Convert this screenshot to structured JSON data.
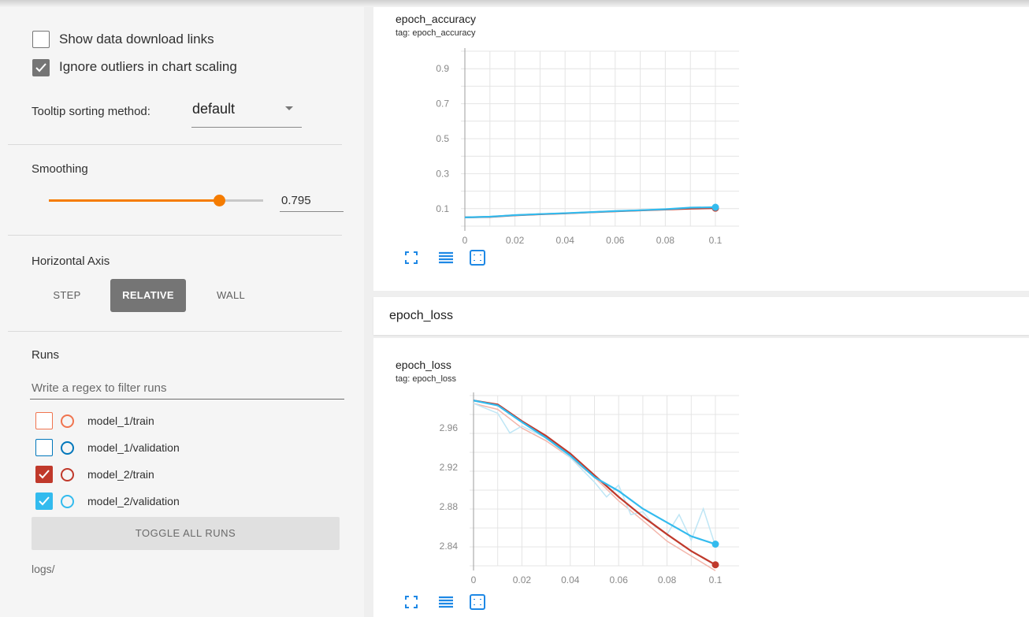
{
  "sidebar": {
    "show_download_links": {
      "label": "Show data download links",
      "checked": false
    },
    "ignore_outliers": {
      "label": "Ignore outliers in chart scaling",
      "checked": true
    },
    "tooltip_sorting": {
      "label": "Tooltip sorting method:",
      "value": "default"
    },
    "smoothing": {
      "label": "Smoothing",
      "value": "0.795",
      "fraction": 0.795
    },
    "horizontal_axis": {
      "label": "Horizontal Axis",
      "options": [
        "STEP",
        "RELATIVE",
        "WALL"
      ],
      "selected": "RELATIVE"
    },
    "runs": {
      "label": "Runs",
      "filter_placeholder": "Write a regex to filter runs",
      "items": [
        {
          "name": "model_1/train",
          "checked": false,
          "color": "#f0744f"
        },
        {
          "name": "model_1/validation",
          "checked": false,
          "color": "#0077bb"
        },
        {
          "name": "model_2/train",
          "checked": true,
          "color": "#c0392b"
        },
        {
          "name": "model_2/validation",
          "checked": true,
          "color": "#33bbee"
        }
      ],
      "toggle_label": "TOGGLE ALL RUNS",
      "log_dir": "logs/"
    }
  },
  "main": {
    "group_title": "epoch_loss",
    "icons": [
      "fit-domain-icon",
      "toggle-log-scale-icon",
      "data-selection-icon"
    ]
  },
  "chart_data": [
    {
      "type": "line",
      "title": "epoch_accuracy",
      "subtitle": "tag: epoch_accuracy",
      "xlim": [
        0,
        0.1
      ],
      "ylim": [
        0,
        1
      ],
      "x_ticks": [
        "0",
        "0.02",
        "0.04",
        "0.06",
        "0.08",
        "0.1"
      ],
      "y_ticks": [
        "0.9",
        "0.7",
        "0.5",
        "0.3",
        "0.1"
      ],
      "grid": true,
      "series": [
        {
          "name": "model_2/train",
          "color": "#c0392b",
          "x": [
            0,
            0.01,
            0.02,
            0.03,
            0.04,
            0.05,
            0.06,
            0.07,
            0.08,
            0.09,
            0.1
          ],
          "y": [
            0.05,
            0.053,
            0.062,
            0.068,
            0.073,
            0.079,
            0.085,
            0.09,
            0.095,
            0.1,
            0.103
          ]
        },
        {
          "name": "model_2/validation",
          "color": "#33bbee",
          "x": [
            0,
            0.01,
            0.02,
            0.03,
            0.04,
            0.05,
            0.06,
            0.07,
            0.08,
            0.09,
            0.1
          ],
          "y": [
            0.05,
            0.054,
            0.063,
            0.069,
            0.074,
            0.08,
            0.086,
            0.091,
            0.097,
            0.106,
            0.108
          ]
        }
      ]
    },
    {
      "type": "line",
      "title": "epoch_loss",
      "subtitle": "tag: epoch_loss",
      "xlim": [
        0,
        0.1
      ],
      "ylim": [
        2.82,
        2.993
      ],
      "x_ticks": [
        "0",
        "0.02",
        "0.04",
        "0.06",
        "0.08",
        "0.1"
      ],
      "y_ticks": [
        "2.96",
        "2.92",
        "2.88",
        "2.84"
      ],
      "grid": true,
      "series": [
        {
          "name": "model_2/train (raw)",
          "color": "#f3b6ab",
          "x": [
            0,
            0.01,
            0.02,
            0.03,
            0.04,
            0.05,
            0.06,
            0.07,
            0.08,
            0.09,
            0.1
          ],
          "y": [
            2.985,
            2.979,
            2.96,
            2.947,
            2.93,
            2.91,
            2.886,
            2.866,
            2.845,
            2.83,
            2.815
          ]
        },
        {
          "name": "model_2/validation (raw)",
          "color": "#bfe6f5",
          "x": [
            0,
            0.01,
            0.015,
            0.02,
            0.03,
            0.04,
            0.05,
            0.055,
            0.06,
            0.065,
            0.07,
            0.075,
            0.08,
            0.085,
            0.09,
            0.095,
            0.1
          ],
          "y": [
            2.985,
            2.975,
            2.955,
            2.962,
            2.95,
            2.93,
            2.905,
            2.89,
            2.902,
            2.872,
            2.875,
            2.86,
            2.852,
            2.872,
            2.846,
            2.878,
            2.84
          ]
        },
        {
          "name": "model_2/train",
          "color": "#c0392b",
          "x": [
            0,
            0.01,
            0.02,
            0.03,
            0.04,
            0.05,
            0.06,
            0.07,
            0.08,
            0.09,
            0.1
          ],
          "y": [
            2.988,
            2.984,
            2.967,
            2.952,
            2.934,
            2.912,
            2.89,
            2.87,
            2.852,
            2.835,
            2.821
          ]
        },
        {
          "name": "model_2/validation",
          "color": "#33bbee",
          "x": [
            0,
            0.01,
            0.02,
            0.03,
            0.04,
            0.05,
            0.06,
            0.07,
            0.08,
            0.09,
            0.1
          ],
          "y": [
            2.988,
            2.983,
            2.966,
            2.95,
            2.932,
            2.91,
            2.896,
            2.878,
            2.864,
            2.85,
            2.842
          ]
        }
      ]
    }
  ]
}
